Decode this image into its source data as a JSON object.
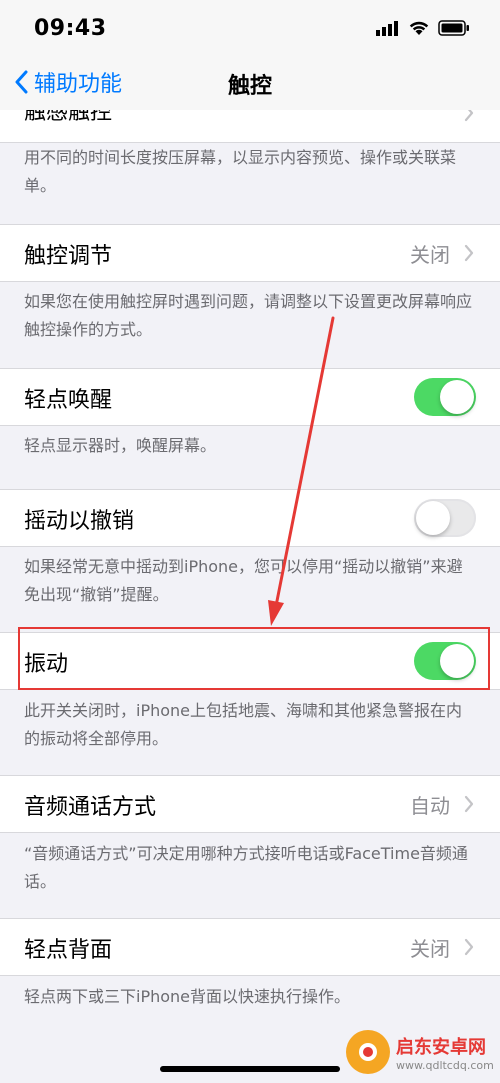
{
  "status": {
    "time": "09:43"
  },
  "nav": {
    "back_label": "辅助功能",
    "title": "触控"
  },
  "partial_row": {
    "label": "触感触控"
  },
  "partial_footer": "用不同的时间长度按压屏幕，以显示内容预览、操作或关联菜单。",
  "rows": [
    {
      "label": "触控调节",
      "value": "关闭",
      "footer": "如果您在使用触控屏时遇到问题，请调整以下设置更改屏幕响应触控操作的方式。"
    },
    {
      "label": "轻点唤醒",
      "toggle_on": true,
      "footer": "轻点显示器时，唤醒屏幕。"
    },
    {
      "label": "摇动以撤销",
      "toggle_on": false,
      "footer": "如果经常无意中摇动到iPhone，您可以停用“摇动以撤销”来避免出现“撤销”提醒。"
    },
    {
      "label": "振动",
      "toggle_on": true,
      "footer": "此开关关闭时，iPhone上包括地震、海啸和其他紧急警报在内的振动将全部停用。"
    },
    {
      "label": "音频通话方式",
      "value": "自动",
      "footer": "“音频通话方式”可决定用哪种方式接听电话或FaceTime音频通话。"
    },
    {
      "label": "轻点背面",
      "value": "关闭",
      "footer": "轻点两下或三下iPhone背面以快速执行操作。"
    }
  ],
  "colors": {
    "accent": "#007aff",
    "toggle_on": "#4cd964",
    "annotation": "#e53935"
  },
  "watermark": {
    "title": "启东安卓网",
    "url": "www.qdltcdq.com"
  }
}
